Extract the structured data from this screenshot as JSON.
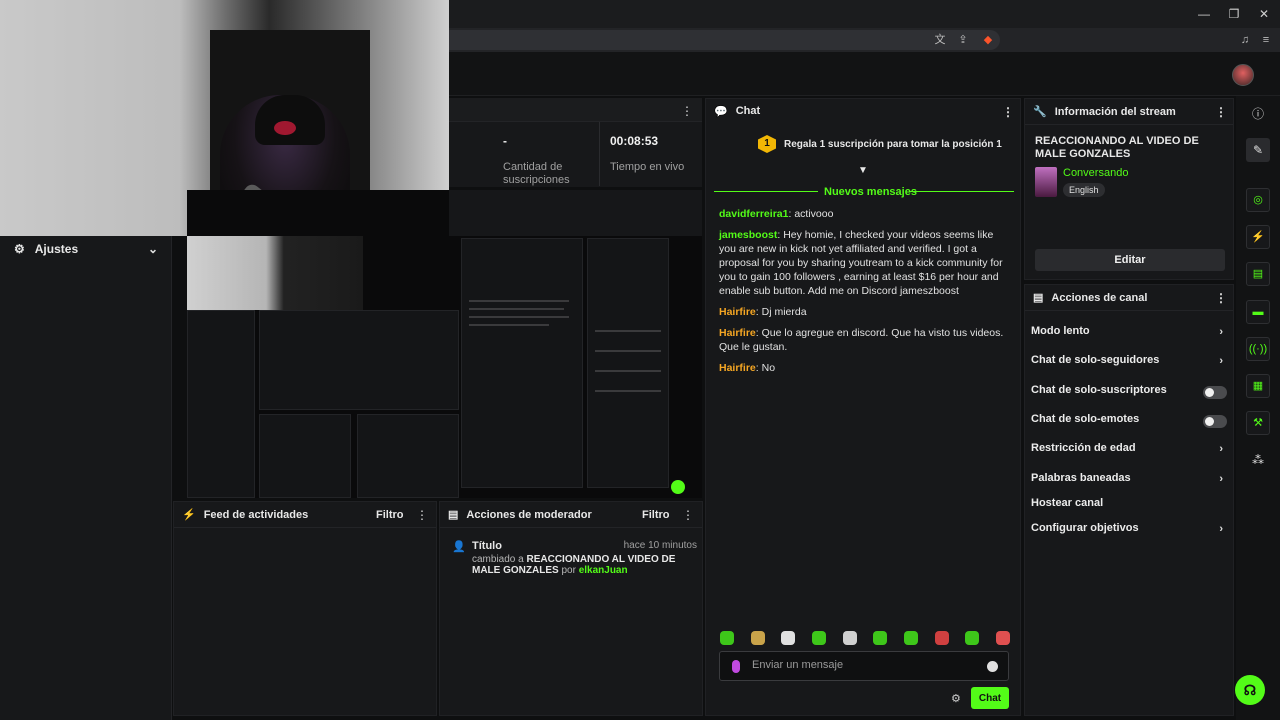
{
  "settings": {
    "label": "Ajustes"
  },
  "stats": [
    {
      "value": "-",
      "label": "Cantidad de suscripciones"
    },
    {
      "value": "00:08:53",
      "label": "Tiempo en vivo"
    }
  ],
  "chat": {
    "title": "Chat",
    "gift_rank": "1",
    "gift_text": "Regala 1 suscripción para tomar la posición 1",
    "new_messages": "Nuevos mensajes",
    "messages": [
      {
        "user": "davidferreira1",
        "text": "activooo"
      },
      {
        "user": "jamesboost",
        "text": "Hey homie, I checked your videos seems like you are new in kick not yet affiliated and verified. I got a proposal for you by sharing youtream to a kick community for you to gain 100 followers , earning at least $16 per hour and enable sub button. Add me on Discord jameszboost"
      },
      {
        "user": "Hairfire",
        "text": "Dj mierda"
      },
      {
        "user": "Hairfire",
        "text": "Que lo agregue en discord. Que ha visto tus videos. Que le gustan."
      },
      {
        "user": "Hairfire",
        "text": "No"
      }
    ],
    "input_placeholder": "Enviar un mensaje",
    "send_label": "Chat"
  },
  "stream_info": {
    "title": "Información del stream",
    "stream_title": "REACCIONANDO AL VIDEO DE MALE GONZALES",
    "category": "Conversando",
    "tag": "English",
    "edit_label": "Editar"
  },
  "channel_actions": {
    "title": "Acciones de canal",
    "items": [
      {
        "label": "Modo lento",
        "control": "arrow"
      },
      {
        "label": "Chat de solo-seguidores",
        "control": "arrow"
      },
      {
        "label": "Chat de solo-suscriptores",
        "control": "toggle"
      },
      {
        "label": "Chat de solo-emotes",
        "control": "toggle"
      },
      {
        "label": "Restricción de edad",
        "control": "arrow"
      },
      {
        "label": "Palabras baneadas",
        "control": "arrow"
      },
      {
        "label": "Hostear canal",
        "control": "none"
      },
      {
        "label": "Configurar objetivos",
        "control": "arrow"
      }
    ]
  },
  "activity_feed": {
    "title": "Feed de actividades",
    "filter": "Filtro"
  },
  "mod_actions": {
    "title": "Acciones de moderador",
    "filter": "Filtro",
    "entry": {
      "title": "Título",
      "time": "hace 10 minutos",
      "prefix": "cambiado a",
      "value": "REACCIONANDO AL VIDEO DE MALE GONZALES",
      "by": "por",
      "user": "elkanJuan"
    }
  },
  "colors": {
    "accent": "#53fc18",
    "background": "#0e0f10",
    "panel": "#17181a"
  }
}
